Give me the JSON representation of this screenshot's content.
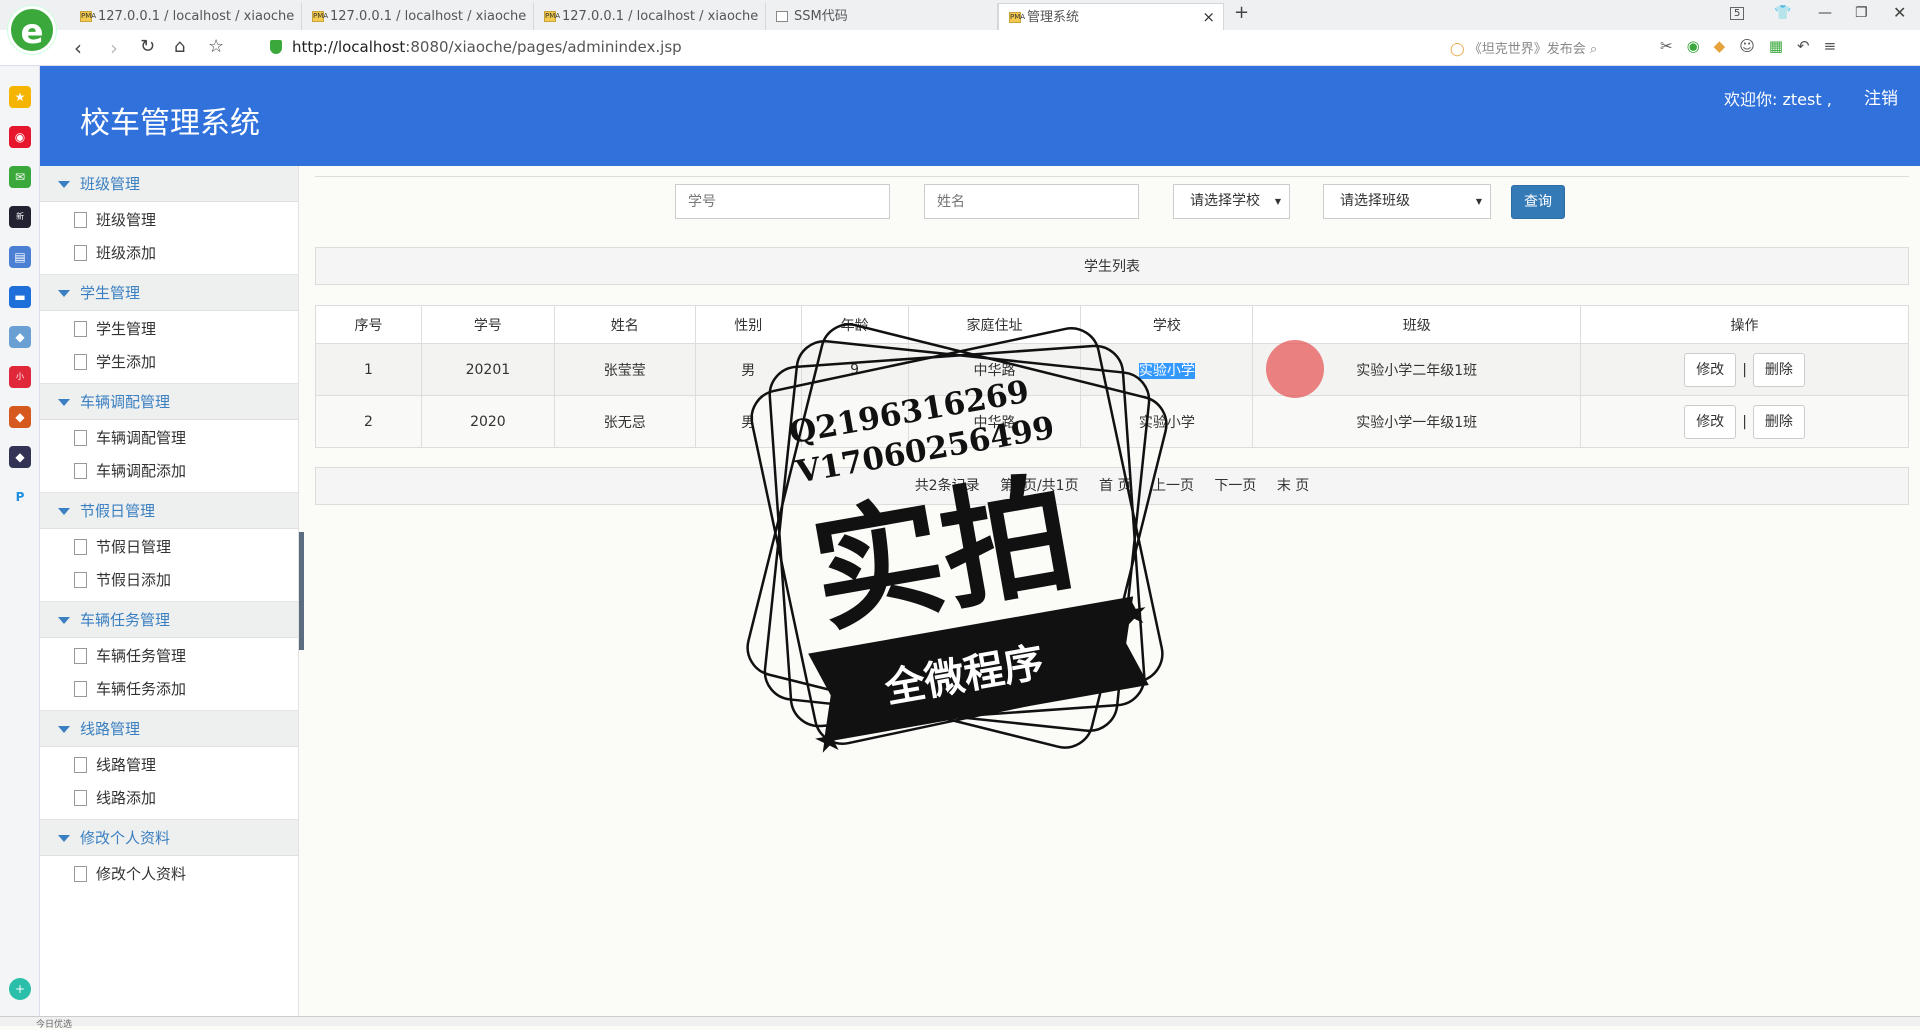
{
  "browser": {
    "tabs": [
      {
        "label": "127.0.0.1 / localhost / xiaoche"
      },
      {
        "label": "127.0.0.1 / localhost / xiaoche"
      },
      {
        "label": "127.0.0.1 / localhost / xiaoche"
      },
      {
        "label": "SSM代码"
      },
      {
        "label": "管理系统"
      }
    ],
    "tab_count": "5",
    "url_host": "http://localhost",
    "url_path": ":8080/xiaoche/pages/adminindex.jsp",
    "search_text": "《坦克世界》发布会",
    "status_text": "今日优选"
  },
  "header": {
    "title": "校车管理系统",
    "welcome": "欢迎你: ztest ,",
    "logout": "注销"
  },
  "sidebar": {
    "groups": [
      {
        "title": "班级管理",
        "items": [
          "班级管理",
          "班级添加"
        ]
      },
      {
        "title": "学生管理",
        "items": [
          "学生管理",
          "学生添加"
        ]
      },
      {
        "title": "车辆调配管理",
        "items": [
          "车辆调配管理",
          "车辆调配添加"
        ]
      },
      {
        "title": "节假日管理",
        "items": [
          "节假日管理",
          "节假日添加"
        ]
      },
      {
        "title": "车辆任务管理",
        "items": [
          "车辆任务管理",
          "车辆任务添加"
        ]
      },
      {
        "title": "线路管理",
        "items": [
          "线路管理",
          "线路添加"
        ]
      },
      {
        "title": "修改个人资料",
        "items": [
          "修改个人资料"
        ]
      }
    ]
  },
  "filters": {
    "student_no_placeholder": "学号",
    "name_placeholder": "姓名",
    "school_select": "请选择学校",
    "class_select": "请选择班级",
    "query": "查询"
  },
  "panel": {
    "title": "学生列表"
  },
  "table": {
    "headers": [
      "序号",
      "学号",
      "姓名",
      "性别",
      "年龄",
      "家庭住址",
      "学校",
      "班级",
      "操作"
    ],
    "rows": [
      {
        "no": "1",
        "student_no": "20201",
        "name": "张莹莹",
        "gender": "男",
        "age": "9",
        "address": "中华路",
        "school": "实验小学",
        "class": "实验小学二年级1班"
      },
      {
        "no": "2",
        "student_no": "2020",
        "name": "张无忌",
        "gender": "男",
        "age": "",
        "address": "中华路",
        "school": "实验小学",
        "class": "实验小学一年级1班"
      }
    ],
    "edit_label": "修改",
    "delete_label": "删除"
  },
  "pager": {
    "summary": "共2条记录",
    "pages": "第1页/共1页",
    "first": "首 页",
    "prev": "上一页",
    "next": "下一页",
    "last": "末 页"
  },
  "watermark": {
    "line1": "Q2196316269",
    "line2": "V17060256499",
    "big": "实拍",
    "ribbon": "全微程序"
  },
  "colors": {
    "banner": "#3071dc",
    "accent": "#337ab7",
    "sidebar_link": "#3a7fc1"
  }
}
